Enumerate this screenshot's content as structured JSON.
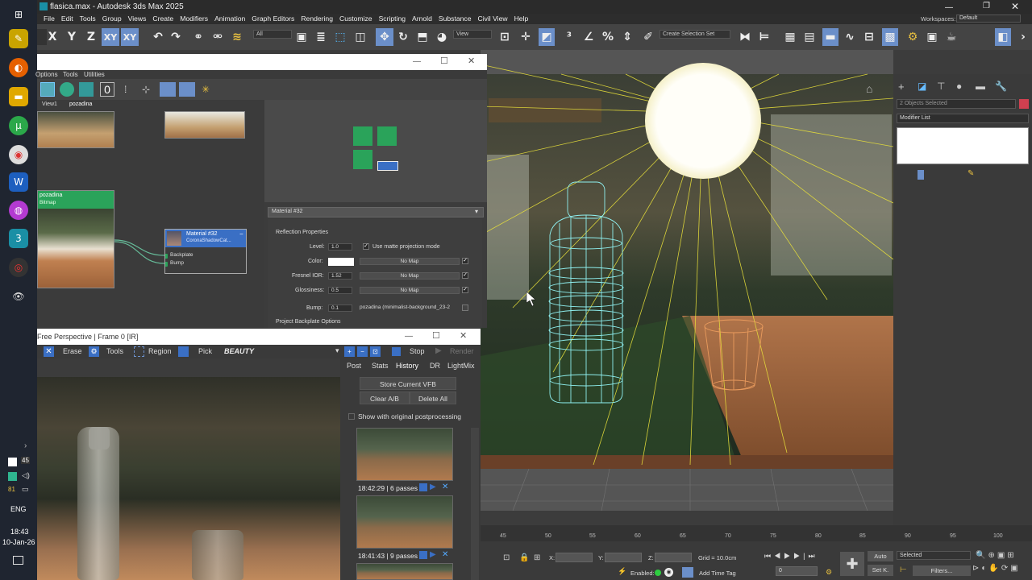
{
  "window": {
    "title": "flasica.max - Autodesk 3ds Max 2025",
    "workspaces_label": "Workspaces:",
    "workspace_value": "Default"
  },
  "menu": [
    "File",
    "Edit",
    "Tools",
    "Group",
    "Views",
    "Create",
    "Modifiers",
    "Animation",
    "Graph Editors",
    "Rendering",
    "Customize",
    "Scripting",
    "Arnold",
    "Substance",
    "Civil View",
    "Help"
  ],
  "toolbar": {
    "axes": [
      "X",
      "Y",
      "Z",
      "XY",
      "XY"
    ],
    "filter_value": "All",
    "view_value": "View",
    "selection_set_placeholder": "Create Selection Set"
  },
  "taskbar": {
    "lang": "ENG",
    "time": "18:43",
    "date": "10-Jan-26",
    "badge_45": "45",
    "badge_81": "81"
  },
  "slate": {
    "menu": [
      "Options",
      "Tools",
      "Utilities"
    ],
    "tabs": [
      "View1",
      "pozadina"
    ],
    "bitmap_node": {
      "title": "pozadina",
      "subtitle": "Bitmap"
    },
    "material_node": {
      "title": "Material #32",
      "subtitle": "CoronaShadowCat...",
      "slots": [
        "Backplate",
        "Bump"
      ]
    },
    "rollout_title": "Material #32",
    "section_reflection": "Reflection Properties",
    "level_label": "Level:",
    "level_value": "1.0",
    "matte_label": "Use matte projection mode",
    "color_label": "Color:",
    "fresnel_label": "Fresnel IOR:",
    "fresnel_value": "1.52",
    "gloss_label": "Glossiness:",
    "gloss_value": "0.5",
    "nomap": "No Map",
    "bump_label": "Bump:",
    "bump_value": "0.1",
    "bump_map": "pozadina (minimalist-background_23-2",
    "section_backplate": "Project Backplate Options"
  },
  "vfb": {
    "title": "Free Perspective | Frame 0 [IR]",
    "toolbar": {
      "erase": "Erase",
      "tools": "Tools",
      "region": "Region",
      "pick": "Pick",
      "channel": "BEAUTY",
      "stop": "Stop",
      "render": "Render"
    },
    "tabs": [
      "Post",
      "Stats",
      "History",
      "DR",
      "LightMix"
    ],
    "store_btn": "Store Current VFB",
    "clear_btn": "Clear A/B",
    "delete_btn": "Delete All",
    "show_original": "Show with original postprocessing",
    "history": [
      {
        "time": "18:42:29 | 6 passes"
      },
      {
        "time": "18:41:43 | 9 passes"
      }
    ]
  },
  "command_panel": {
    "selection": "2 Objects Selected",
    "modifier_list": "Modifier List"
  },
  "timeline": {
    "ticks": [
      "45",
      "50",
      "55",
      "60",
      "65",
      "70",
      "75",
      "80",
      "85",
      "90",
      "95",
      "100"
    ],
    "x_label": "X:",
    "y_label": "Y:",
    "z_label": "Z:",
    "grid": "Grid = 10.0cm",
    "enabled": "Enabled:",
    "add_time_tag": "Add Time Tag",
    "frame_value": "0",
    "auto": "Auto",
    "set_key": "Set K.",
    "selected": "Selected",
    "filters": "Filters..."
  },
  "colors": {
    "accent": "#1e90ff",
    "node_green": "#2aa35a",
    "material_blue": "#3a6fc4",
    "wire_yellow": "#e8e03a",
    "wire_cyan": "#8ff0f0"
  }
}
